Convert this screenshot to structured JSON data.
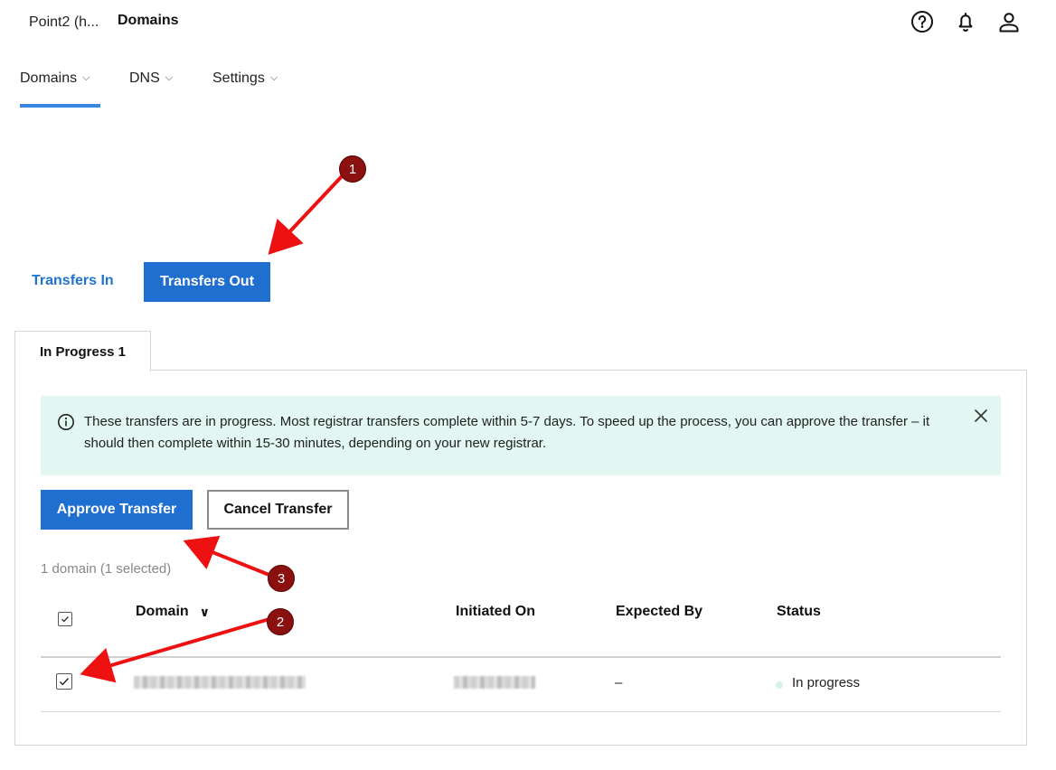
{
  "header": {
    "account_name": "Point2 (h...",
    "page_title": "Domains",
    "icons": [
      "help-icon",
      "bell-icon",
      "user-icon"
    ]
  },
  "nav": {
    "items": [
      {
        "label": "Domains",
        "active": true
      },
      {
        "label": "DNS",
        "active": false
      },
      {
        "label": "Settings",
        "active": false
      }
    ],
    "chevron": "⌵",
    "accent_color": "#3a86e0"
  },
  "transfer_toggle": {
    "in_label": "Transfers In",
    "out_label": "Transfers Out",
    "selected": "Transfers Out"
  },
  "tabs": [
    {
      "label": "In Progress 1",
      "active": true
    }
  ],
  "notice": {
    "text": "These transfers are in progress. Most registrar transfers complete within 5-7 days. To speed up the process, you can approve the transfer – it should then complete within 15-30 minutes, depending on your new registrar.",
    "background": "#e2f6f2"
  },
  "actions": {
    "approve_label": "Approve Transfer",
    "cancel_label": "Cancel Transfer",
    "primary_color": "#1f6fd1"
  },
  "summary": "1 domain (1 selected)",
  "table": {
    "columns": [
      "Domain",
      "Initiated On",
      "Expected By",
      "Status"
    ],
    "sort_chevron": "∨",
    "rows": [
      {
        "domain": "",
        "initiated_on": "",
        "expected_by": "–",
        "status": "In progress",
        "checked": true
      }
    ]
  },
  "annotations": {
    "badges": [
      "1",
      "2",
      "3"
    ],
    "color": "#8b1010",
    "arrow_color": "#ee1111"
  }
}
